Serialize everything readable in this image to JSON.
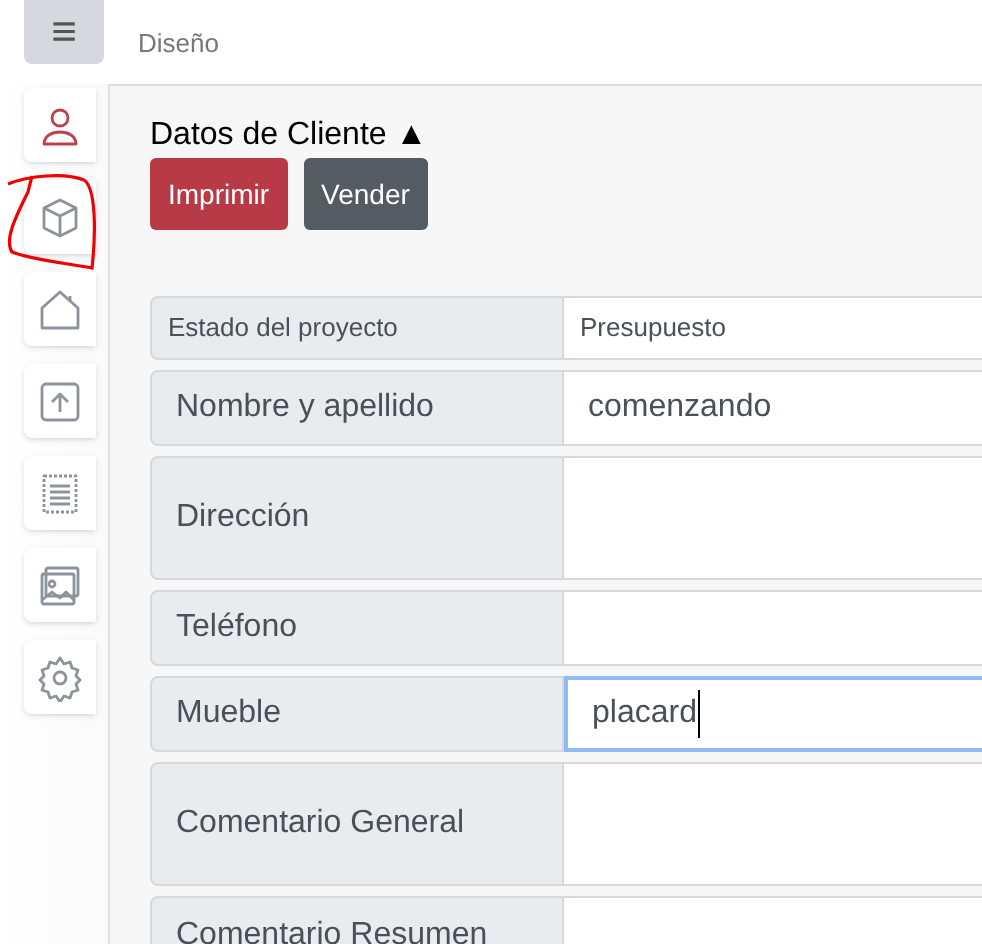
{
  "menu_button": {
    "label": "≡"
  },
  "breadcrumb": "Diseño",
  "sidebar": {
    "items": [
      {
        "selected": true
      },
      {
        "selected": false
      },
      {
        "selected": false
      },
      {
        "selected": false
      },
      {
        "selected": false
      },
      {
        "selected": false
      },
      {
        "selected": false
      }
    ]
  },
  "panel": {
    "title": "Datos de Cliente ▲",
    "buttons": [
      {
        "label": "Imprimir",
        "kind": "danger"
      },
      {
        "label": "Vender",
        "kind": "secondary"
      }
    ],
    "fields": [
      {
        "label": "Estado del proyecto",
        "value": "Presupuesto",
        "kind": "compact",
        "focused": false
      },
      {
        "label": "Nombre y apellido",
        "value": "comenzando",
        "kind": "single",
        "focused": false
      },
      {
        "label": "Dirección",
        "kind": "multi",
        "focused": false
      },
      {
        "label": "Teléfono",
        "kind": "single",
        "focused": false
      },
      {
        "label": "Mueble",
        "value": "placard",
        "kind": "single",
        "focused": true
      },
      {
        "label": "Comentario General",
        "kind": "multi",
        "focused": false
      },
      {
        "label": "Comentario Resumen",
        "kind": "last",
        "focused": false
      }
    ]
  }
}
